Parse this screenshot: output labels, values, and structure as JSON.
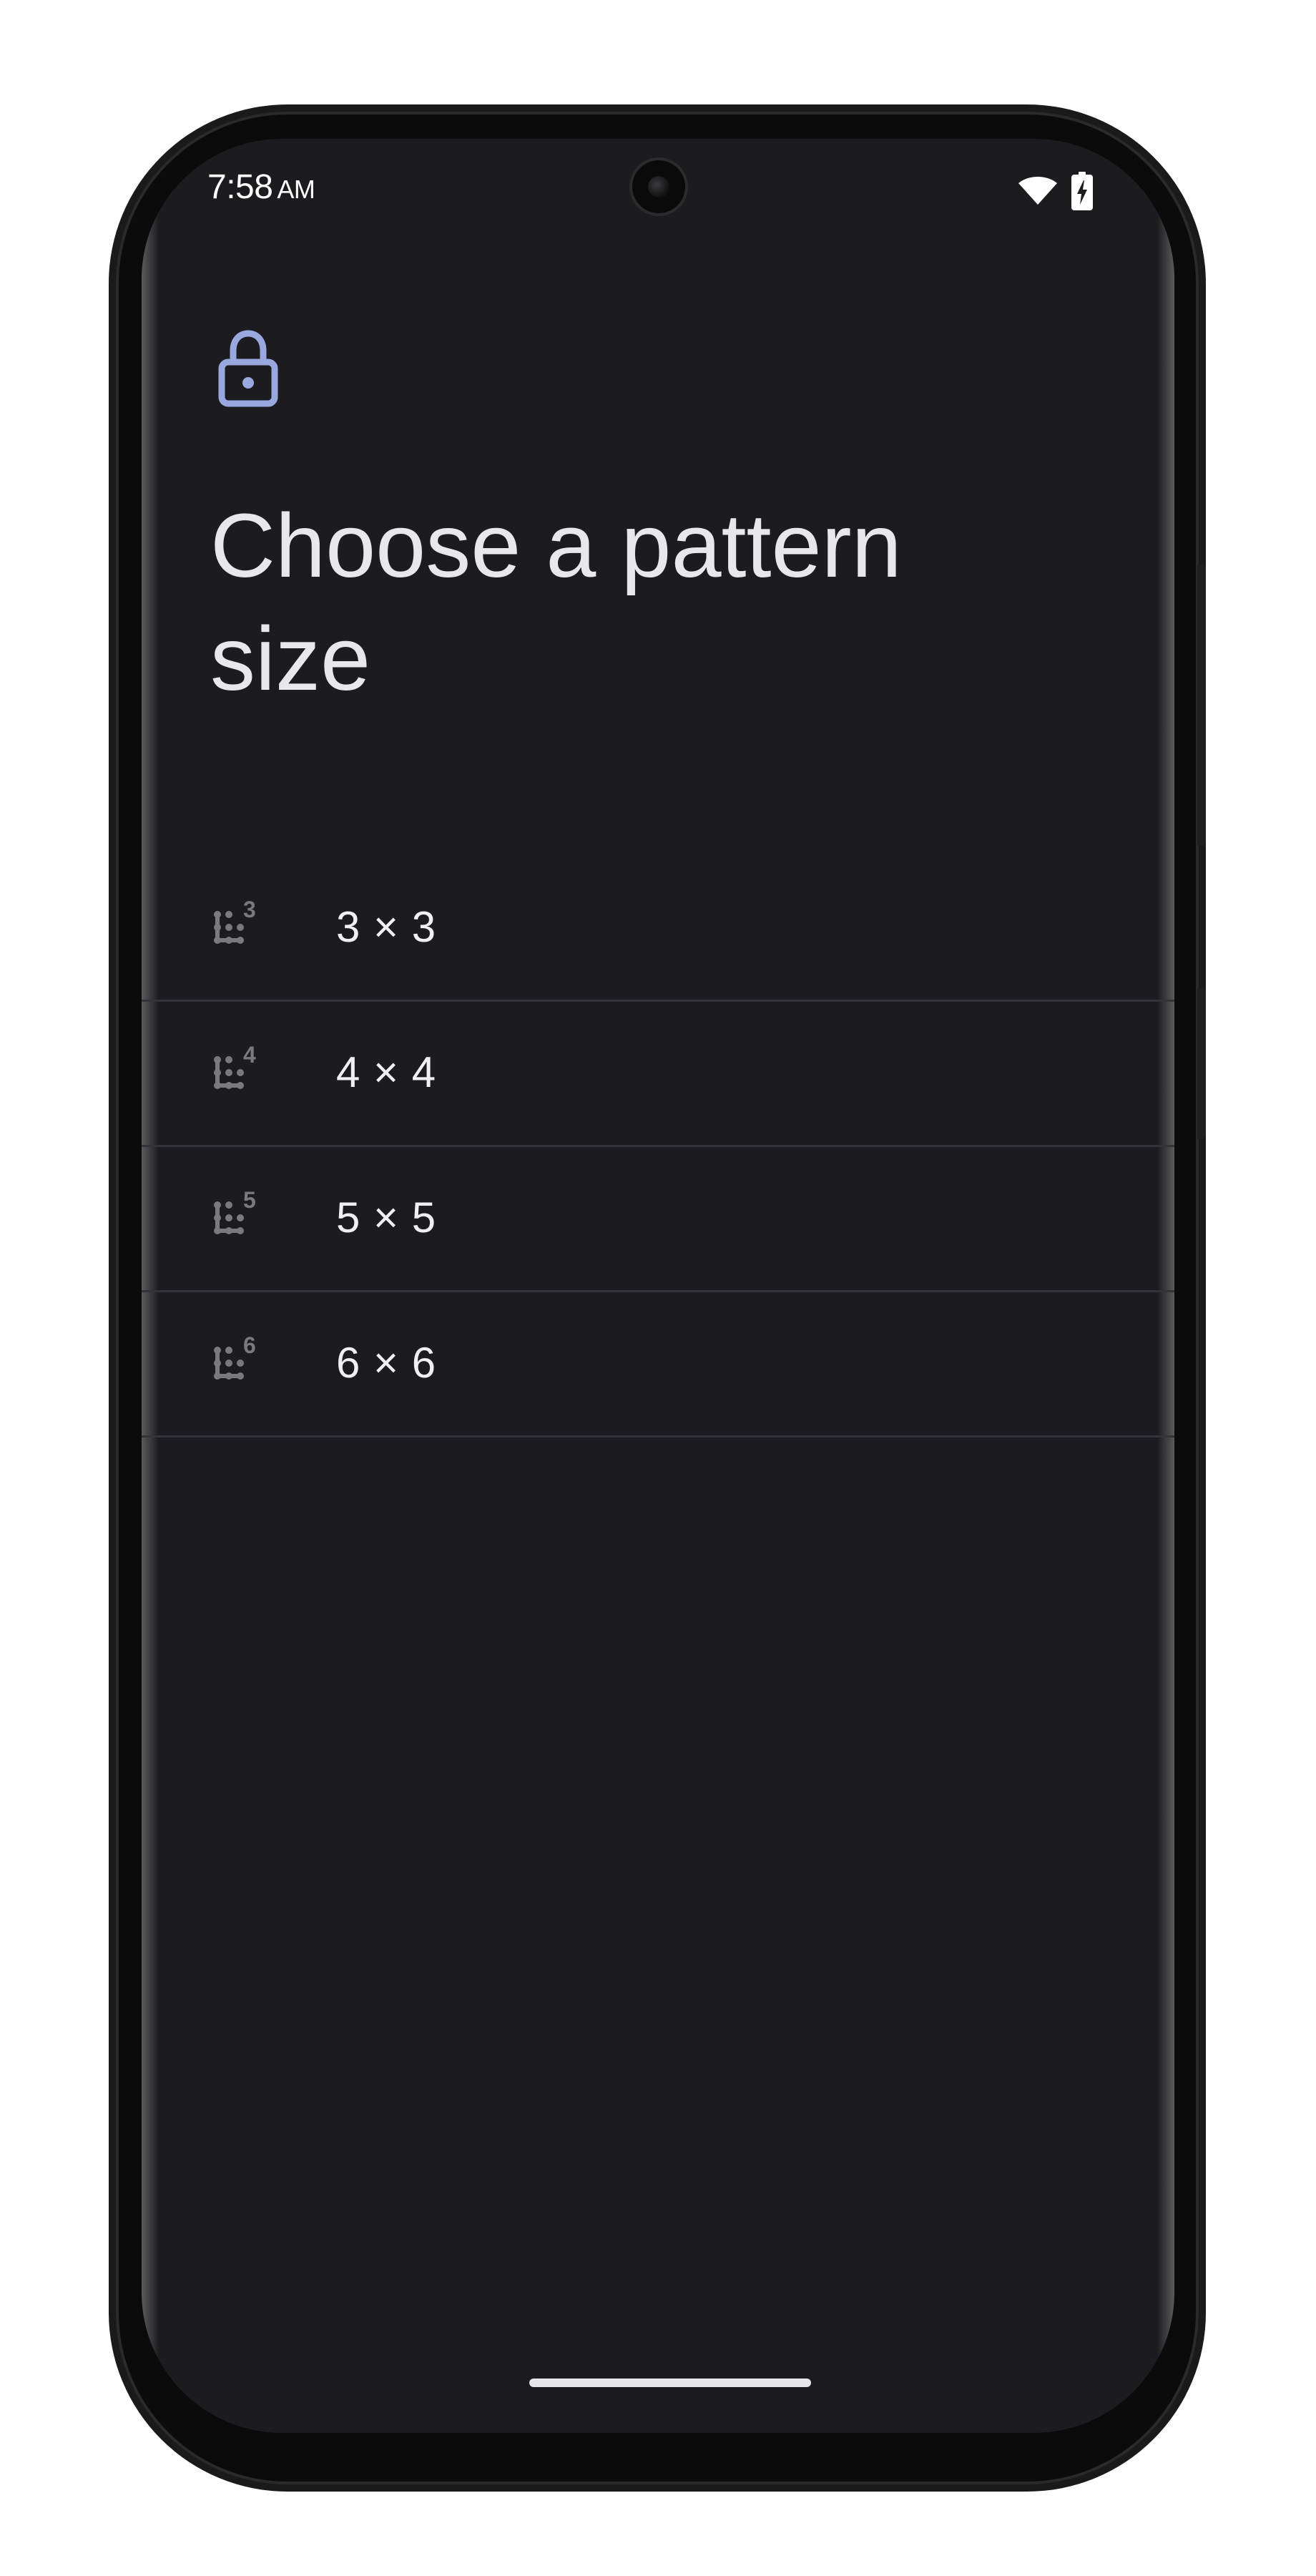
{
  "status_bar": {
    "time": "7:58",
    "ampm": "AM",
    "wifi_icon": "wifi-icon",
    "battery_icon": "battery-charging-icon"
  },
  "header": {
    "icon": "lock-icon",
    "title": "Choose a pattern size"
  },
  "size_options": [
    {
      "icon": "pattern-grid-3-icon",
      "badge": "3",
      "label": "3 × 3"
    },
    {
      "icon": "pattern-grid-4-icon",
      "badge": "4",
      "label": "4 × 4"
    },
    {
      "icon": "pattern-grid-5-icon",
      "badge": "5",
      "label": "5 × 5"
    },
    {
      "icon": "pattern-grid-6-icon",
      "badge": "6",
      "label": "6 × 6"
    }
  ],
  "colors": {
    "background": "#1c1c20",
    "accent": "#9aa8e0",
    "text": "#e8e8ec",
    "divider": "#33343a",
    "icon_gray": "#7a7a7e"
  }
}
